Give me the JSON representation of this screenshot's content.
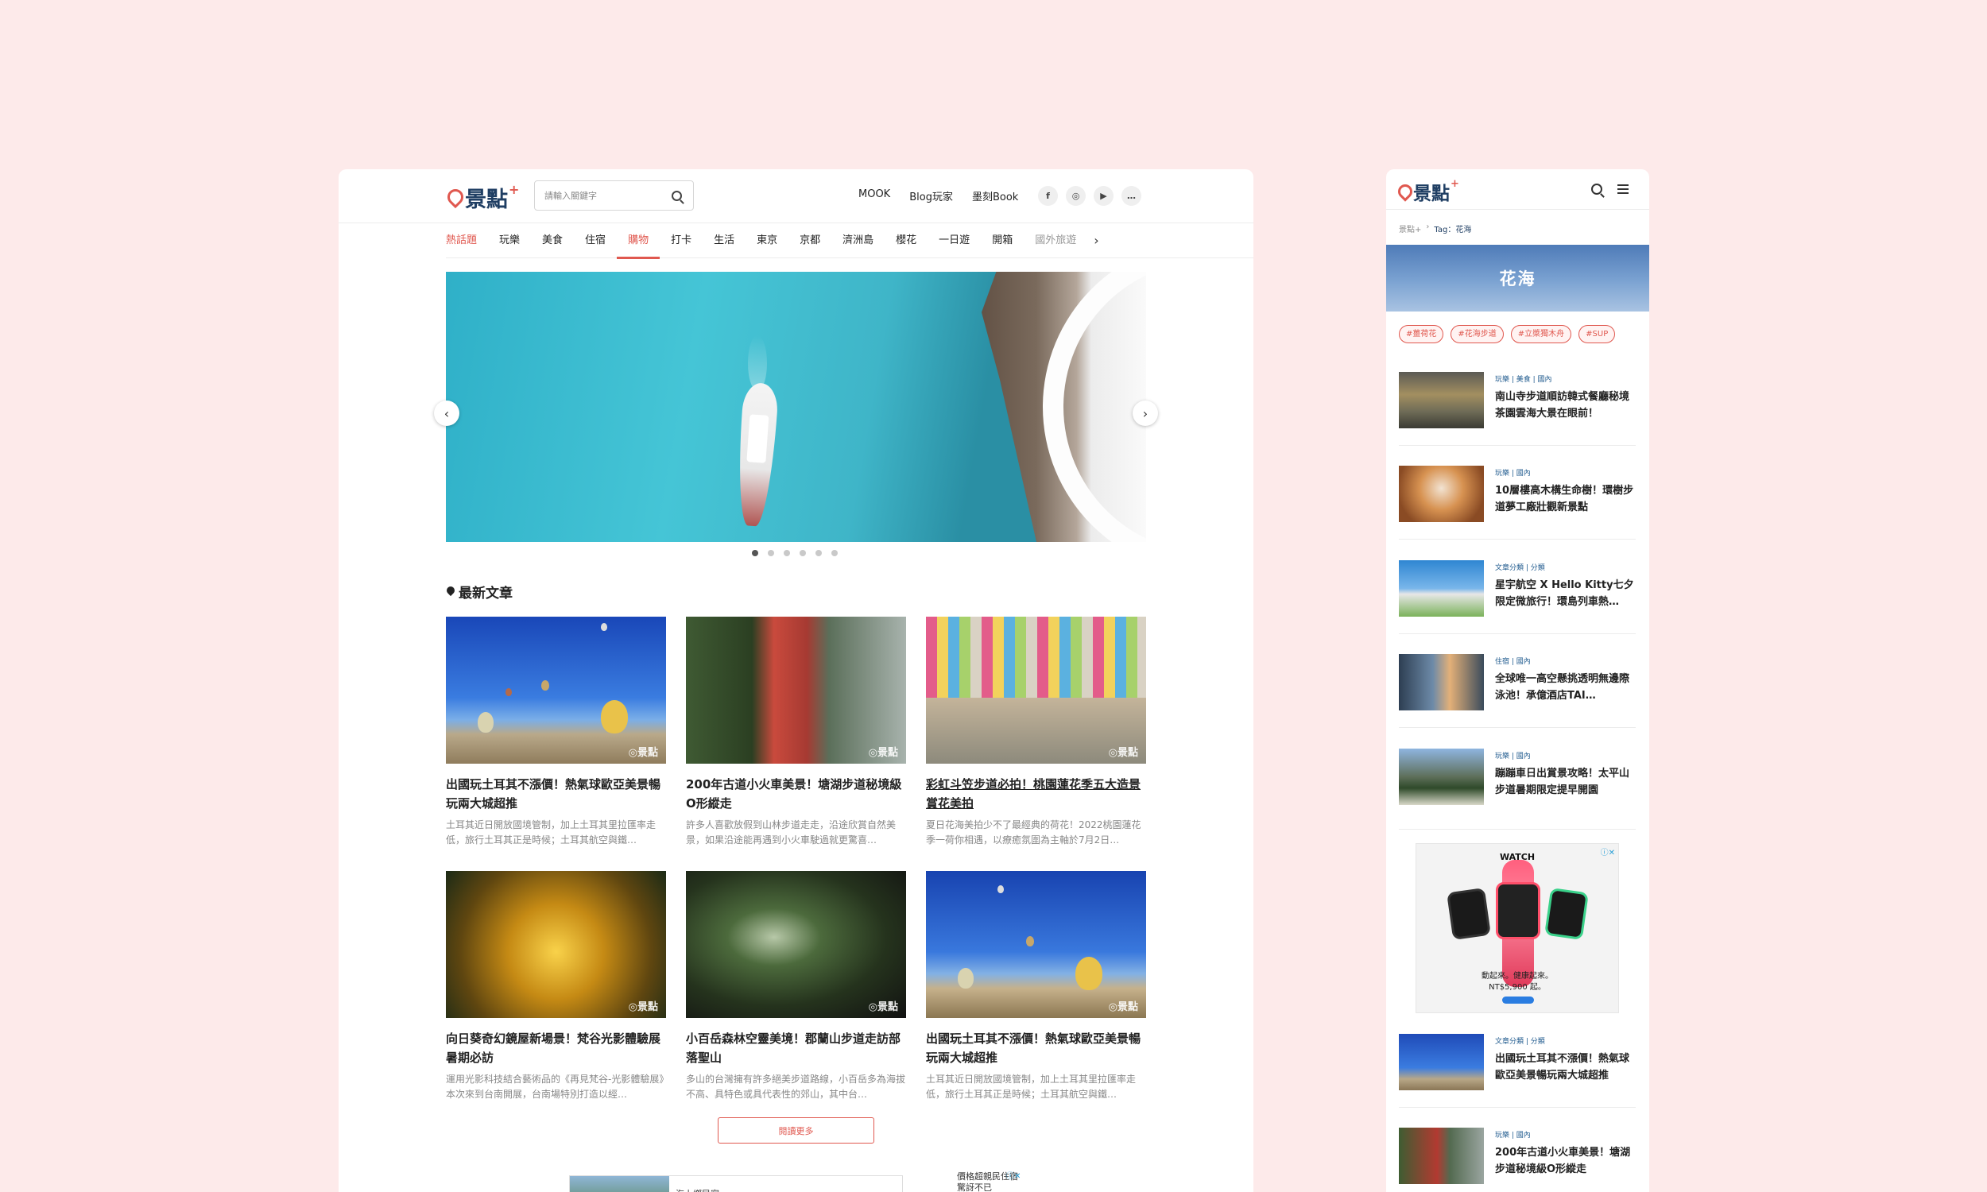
{
  "desktop": {
    "logo_text": "景點",
    "logo_plus": "+",
    "search_placeholder": "請輸入關鍵字",
    "nav": [
      "MOOK",
      "Blog玩家",
      "墨刻Book"
    ],
    "social": [
      "f",
      "◎",
      "▶",
      "…"
    ],
    "categories": [
      "熱話題",
      "玩樂",
      "美食",
      "住宿",
      "購物",
      "打卡",
      "生活",
      "東京",
      "京都",
      "濟洲島",
      "櫻花",
      "一日遊",
      "開箱",
      "國外旅遊"
    ],
    "active_category": "購物",
    "carousel": {
      "total_slides": 6,
      "active_index": 0
    },
    "latest_heading": "最新文章",
    "watermark": "◎景點",
    "articles": [
      {
        "title": "出國玩土耳其不漲價！熱氣球歐亞美景暢玩兩大城超推",
        "desc": "土耳其近日開放國境管制，加上土耳其里拉匯率走低，旅行土耳其正是時候；土耳其航空與鐵…"
      },
      {
        "title": "200年古道小火車美景！塘湖步道秘境級O形縱走",
        "desc": "許多人喜歡放假到山林步道走走，沿途欣賞自然美景，如果沿途能再遇到小火車駛過就更驚喜…"
      },
      {
        "title": "彩虹斗笠步道必拍！桃園蓮花季五大造景賞花美拍",
        "desc": "夏日花海美拍少不了最經典的荷花！2022桃園蓮花季一荷你相遇，以療癒氛圍為主軸於7月2日…"
      },
      {
        "title": "向日葵奇幻鏡屋新場景！梵谷光影體驗展暑期必訪",
        "desc": "運用光影科技結合藝術品的《再見梵谷-光影體驗展》本次來到台南開展，台南場特別打造以經…"
      },
      {
        "title": "小百岳森林空靈美境！郡蘭山步道走訪部落聖山",
        "desc": "多山的台灣擁有許多絕美步道路線，小百岳多為海拔不高、具特色或具代表性的郊山，其中台…"
      },
      {
        "title": "出國玩土耳其不漲價！熱氣球歐亞美景暢玩兩大城超推",
        "desc": "土耳其近日開放國境管制，加上土耳其里拉匯率走低，旅行土耳其正是時候；土耳其航空與鐵…"
      }
    ],
    "read_more": "閱讀更多",
    "ad_left_text": "海上鄉民宿",
    "ad_right_text": "價格超親民住宿\n驚訝不已",
    "ad_choice": "ⓘ✕"
  },
  "mobile": {
    "logo_text": "景點",
    "logo_plus": "+",
    "breadcrumb": [
      "景點+",
      "Tag：花海"
    ],
    "banner_title": "花海",
    "tags": [
      "#薑荷花",
      "#花海步道",
      "#立槳獨木舟",
      "#SUP"
    ],
    "items": [
      {
        "cat": "玩樂 | 美食 | 國內",
        "title": "南山寺步道順訪韓式餐廳秘境茶園雲海大景在眼前！"
      },
      {
        "cat": "玩樂 | 國內",
        "title": "10層樓高木構生命樹！環樹步道夢工廠壯觀新景點"
      },
      {
        "cat": "文章分類 | 分類",
        "title": "星宇航空 X Hello Kitty七夕限定微旅行！環島列車熱…"
      },
      {
        "cat": "住宿 | 國內",
        "title": "全球唯一高空懸挑透明無邊際泳池！承億酒店TAI…"
      },
      {
        "cat": "玩樂 | 國內",
        "title": "蹦蹦車日出賞景攻略！太平山步道暑期限定提早開園"
      },
      {
        "cat": "文章分類 | 分類",
        "title": "出國玩土耳其不漲價！熱氣球歐亞美景暢玩兩大城超推"
      },
      {
        "cat": "玩樂 | 國內",
        "title": "200年古道小火車美景！塘湖步道秘境級O形縱走"
      }
    ],
    "ad": {
      "brand": "WATCH",
      "copy_line1": "動起來。健康起來。",
      "copy_line2": "NT$5,900 起。",
      "choice": "ⓘ✕"
    }
  }
}
